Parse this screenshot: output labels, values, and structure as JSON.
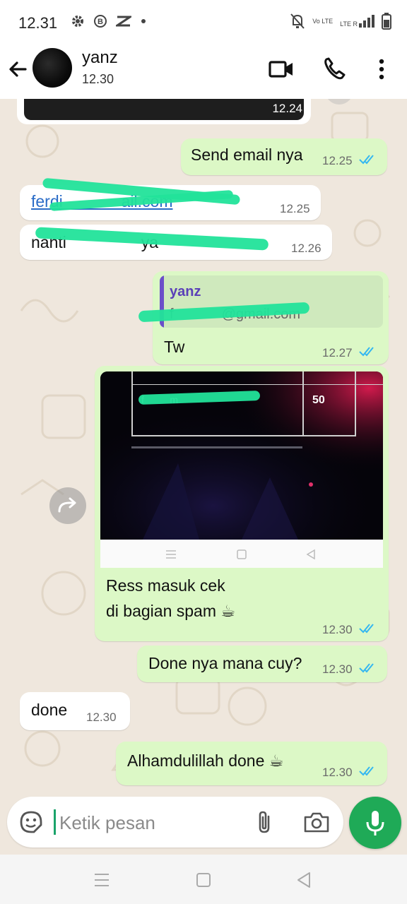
{
  "status_bar": {
    "time": "12.31",
    "icons_left": [
      "gear-icon",
      "b-badge-icon",
      "capcut-icon",
      "dot-icon"
    ],
    "icons_right": [
      "mute-icon",
      "volte-icon",
      "lte-signal-icon",
      "battery-icon"
    ],
    "net_label_1": "Vo LTE",
    "net_label_2": "LTE R"
  },
  "header": {
    "contact_name": "yanz",
    "subtitle": "12.30"
  },
  "messages": {
    "prev_image_time": "12.24",
    "m1": {
      "text": "Send email nya",
      "time": "12.25"
    },
    "m2": {
      "text": "ferdi                  ail.com",
      "time": "12.25"
    },
    "m3": {
      "text": "nanti                       ya",
      "time": "12.26"
    },
    "m4": {
      "reply_name": "yanz",
      "reply_text": "f                 @gmail.com",
      "text": "Tw",
      "time": "12.27"
    },
    "m5": {
      "screenshot_cell": "f             m",
      "screenshot_value": "50",
      "line1": "Ress masuk cek",
      "line2": "di bagian spam ☕",
      "time": "12.30"
    },
    "m6": {
      "text": "Done nya mana cuy?",
      "time": "12.30"
    },
    "m7": {
      "text": "done",
      "time": "12.30"
    },
    "m8": {
      "text": "Alhamdulillah done ☕",
      "time": "12.30"
    }
  },
  "composer": {
    "placeholder": "Ketik pesan"
  },
  "colors": {
    "outgoing_bubble": "#dcf8c6",
    "incoming_bubble": "#ffffff",
    "read_tick": "#34b7f1",
    "accent_green": "#1faa57",
    "link": "#2a6cc7"
  }
}
